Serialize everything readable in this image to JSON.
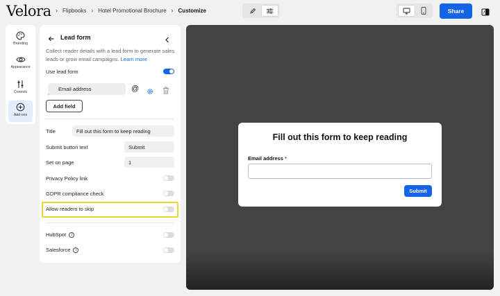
{
  "brand": {
    "logo_text": "Velora"
  },
  "breadcrumb": {
    "items": [
      "Flipbooks",
      "Hotel Promotional Brochure"
    ],
    "current": "Customize"
  },
  "toolbar": {
    "edit_icon": "pencil-icon",
    "settings_icon": "sliders-icon",
    "active_mode": "settings"
  },
  "device": {
    "desktop_icon": "desktop-icon",
    "mobile_icon": "mobile-icon",
    "active": "desktop"
  },
  "share_label": "Share",
  "rail": [
    {
      "label": "Branding",
      "icon": "palette-icon"
    },
    {
      "label": "Appearance",
      "icon": "eye-icon"
    },
    {
      "label": "Controls",
      "icon": "sliders-vertical-icon"
    },
    {
      "label": "Add-ons",
      "icon": "plus-circle-icon",
      "active": true
    }
  ],
  "panel": {
    "title": "Lead form",
    "description": "Collect reader details with a lead form to generate sales leads or grow email campaigns.",
    "learn_more": "Learn more",
    "use_lead_form": {
      "label": "Use lead form",
      "on": true
    },
    "field": {
      "label": "Email address"
    },
    "add_field_label": "Add field",
    "settings": {
      "title_label": "Title",
      "title_value": "Fill out this form to keep reading",
      "submit_label": "Submit button text",
      "submit_value": "Submit",
      "page_label": "Set on page",
      "page_value": "1"
    },
    "toggles": {
      "privacy": {
        "label": "Privacy Policy link",
        "on": false
      },
      "gdpr": {
        "label": "GDPR compliance check",
        "on": false
      },
      "skip": {
        "label": "Allow readers to skip",
        "on": false
      }
    },
    "integrations": {
      "hubspot": {
        "label": "HubSpot",
        "on": false
      },
      "salesforce": {
        "label": "Salesforce",
        "on": false
      }
    }
  },
  "preview": {
    "modal_title": "Fill out this form to keep reading",
    "field_label": "Email address",
    "required_mark": "*",
    "submit_label": "Submit"
  },
  "colors": {
    "accent": "#1463e8",
    "highlight": "#f1d32a",
    "preview_bg": "#434343"
  }
}
